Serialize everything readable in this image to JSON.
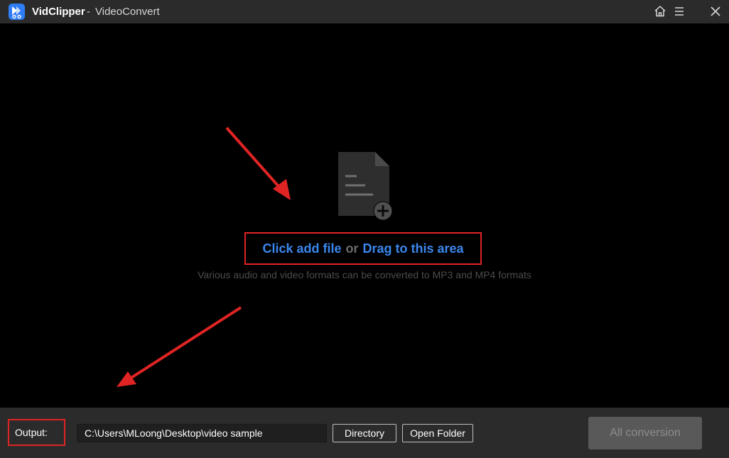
{
  "titlebar": {
    "app_name": "VidClipper",
    "separator": "-",
    "module": "VideoConvert",
    "icons": {
      "logo": "vidclipper-logo-icon",
      "home": "home-icon",
      "menu": "menu-icon",
      "close": "close-icon"
    }
  },
  "dropzone": {
    "click_add": "Click add file",
    "or": "or",
    "drag": "Drag to this area",
    "hint": "Various audio and video formats can be converted to MP3 and MP4 formats",
    "icon": "file-add-icon"
  },
  "bottombar": {
    "output_label": "Output:",
    "output_path": "C:\\Users\\MLoong\\Desktop\\video sample",
    "directory_button": "Directory",
    "open_folder_button": "Open Folder",
    "all_conversion_button": "All conversion"
  },
  "colors": {
    "titlebar_bg": "#2b2b2b",
    "main_bg": "#000000",
    "link_blue": "#3b87ee",
    "highlight_red": "#e02424",
    "disabled_button": "#595959"
  }
}
